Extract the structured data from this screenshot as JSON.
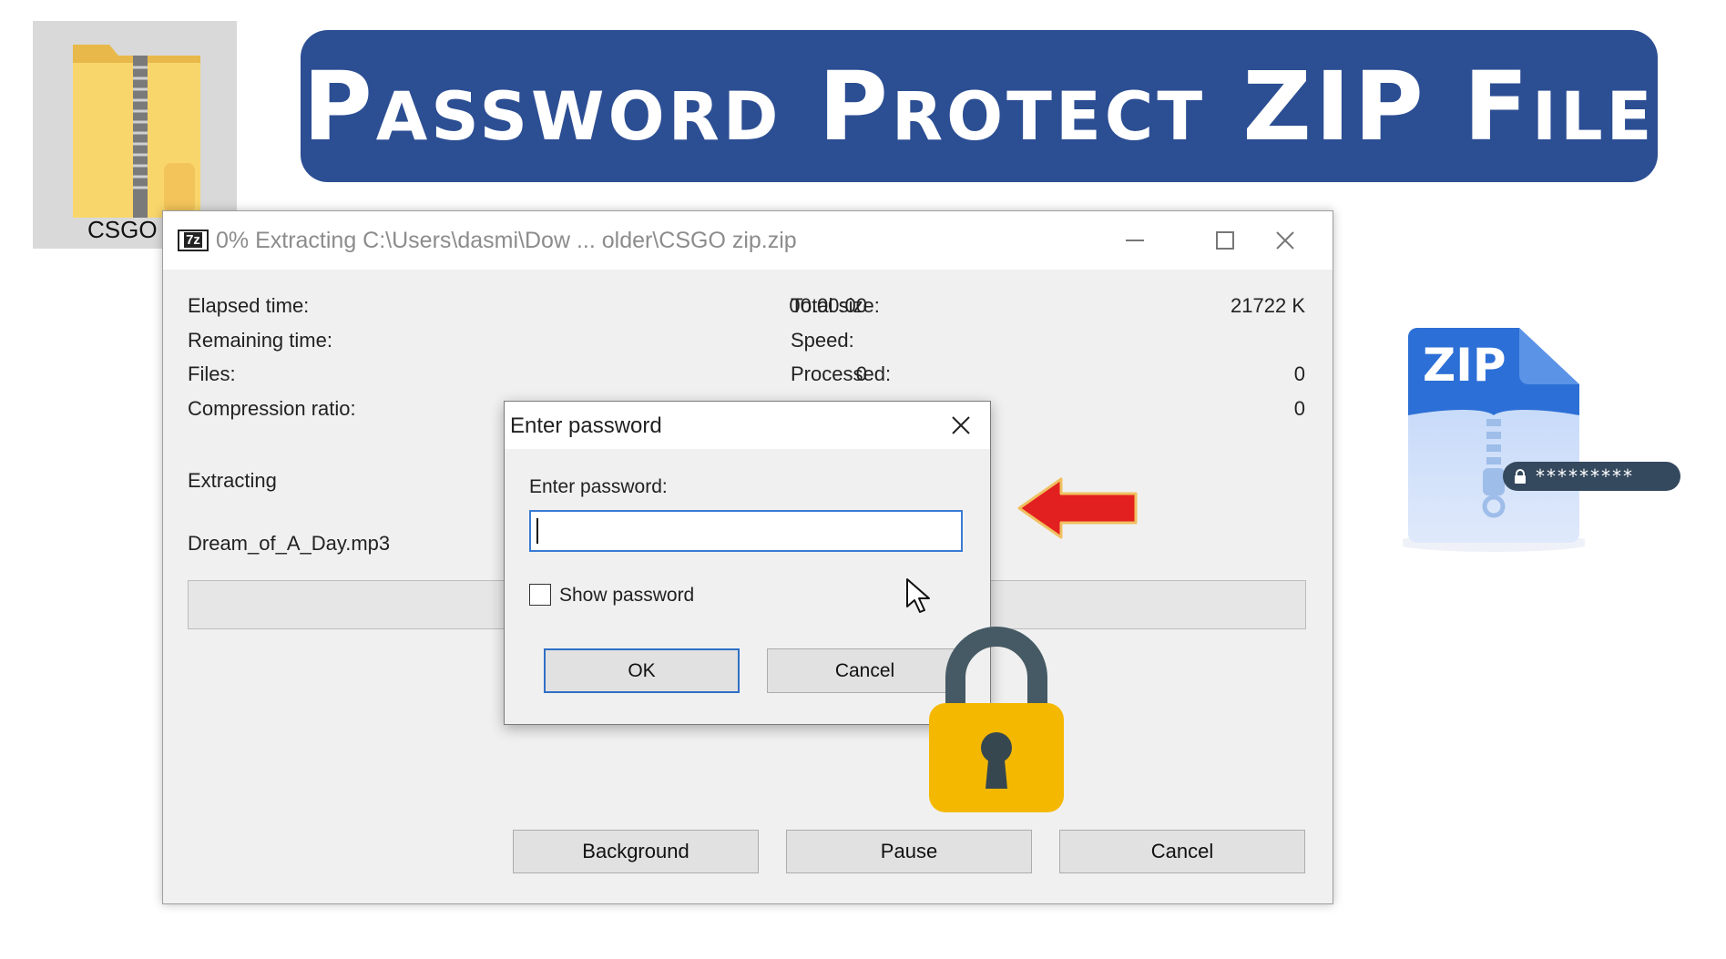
{
  "banner": {
    "title": "Password Protect ZIP File"
  },
  "desktop": {
    "folder_label": "CSGO z"
  },
  "window": {
    "app_icon_text": "7z",
    "title": "0% Extracting C:\\Users\\dasmi\\Dow ... older\\CSGO zip.zip",
    "controls": {
      "minimize": "—",
      "maximize": "☐",
      "close": "✕"
    },
    "stats": {
      "elapsed_label": "Elapsed time:",
      "elapsed_value": "00:00:00",
      "remaining_label": "Remaining time:",
      "files_label": "Files:",
      "files_value": "0",
      "compression_label": "Compression ratio:",
      "total_size_label": "Total size:",
      "total_size_value": "21722 K",
      "speed_label": "Speed:",
      "processed_label": "Processed:",
      "processed_value": "0",
      "packed_value": "0"
    },
    "status_label": "Extracting",
    "current_file": "Dream_of_A_Day.mp3",
    "progress": 0,
    "buttons": {
      "background": "Background",
      "pause": "Pause",
      "cancel": "Cancel"
    }
  },
  "password_dialog": {
    "title": "Enter password",
    "field_label": "Enter password:",
    "field_value": "",
    "show_password_label": "Show password",
    "show_password_checked": false,
    "ok_label": "OK",
    "cancel_label": "Cancel"
  },
  "zip_badge": {
    "label": "ZIP",
    "masked_password": "*********"
  },
  "icons": {
    "folder": "zip-folder-icon",
    "arrow": "red-arrow-icon",
    "cursor": "mouse-cursor-icon",
    "padlock": "padlock-icon",
    "zip": "zip-file-icon"
  },
  "colors": {
    "banner": "#2c4e93",
    "arrow": "#e32020",
    "padlock_body": "#f5b800",
    "padlock_shackle": "#455a64",
    "zip_top": "#2c6fd6",
    "zip_bottom": "#cfe0fb",
    "dialog_focus": "#3a7bd5"
  }
}
